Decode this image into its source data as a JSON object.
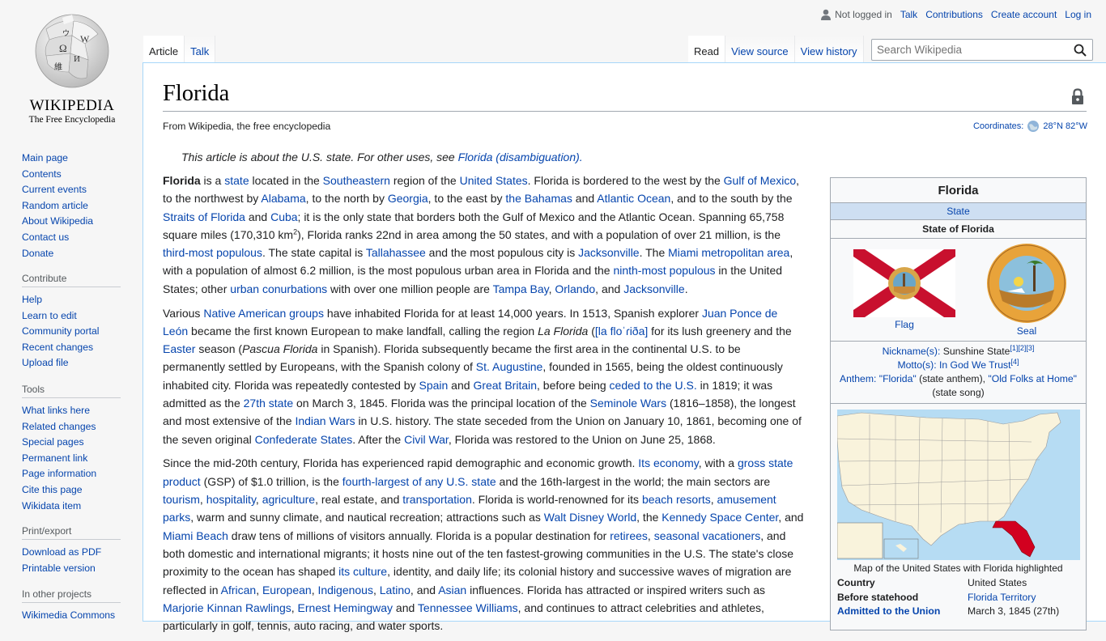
{
  "logo": {
    "wordmark": "WIKIPEDIA",
    "tagline": "The Free Encyclopedia"
  },
  "personal": {
    "not_logged_in": "Not logged in",
    "talk": "Talk",
    "contributions": "Contributions",
    "create_account": "Create account",
    "log_in": "Log in"
  },
  "tabs": {
    "article": "Article",
    "talk": "Talk",
    "read": "Read",
    "view_source": "View source",
    "view_history": "View history"
  },
  "search": {
    "placeholder": "Search Wikipedia"
  },
  "navigation": [
    "Main page",
    "Contents",
    "Current events",
    "Random article",
    "About Wikipedia",
    "Contact us",
    "Donate"
  ],
  "contribute": {
    "heading": "Contribute",
    "items": [
      "Help",
      "Learn to edit",
      "Community portal",
      "Recent changes",
      "Upload file"
    ]
  },
  "tools": {
    "heading": "Tools",
    "items": [
      "What links here",
      "Related changes",
      "Special pages",
      "Permanent link",
      "Page information",
      "Cite this page",
      "Wikidata item"
    ]
  },
  "print": {
    "heading": "Print/export",
    "items": [
      "Download as PDF",
      "Printable version"
    ]
  },
  "projects": {
    "heading": "In other projects",
    "items": [
      "Wikimedia Commons"
    ]
  },
  "article": {
    "title": "Florida",
    "from": "From Wikipedia, the free encyclopedia",
    "coords_label": "Coordinates:",
    "coords_value": "28°N 82°W",
    "hatnote_text": "This article is about the U.S. state. For other uses, see ",
    "hatnote_link": "Florida (disambiguation)."
  },
  "infobox": {
    "title": "Florida",
    "type": "State",
    "official": "State of Florida",
    "flag_caption": "Flag",
    "seal_caption": "Seal",
    "nickname_label": "Nickname(s):",
    "nickname": "Sunshine State",
    "nickname_refs": "[1][2][3]",
    "motto_label": "Motto(s):",
    "motto": "In God We Trust",
    "motto_ref": "[4]",
    "anthem_label": "Anthem:",
    "anthem1": "\"Florida\"",
    "anthem1_note": "(state anthem),",
    "anthem2": "\"Old Folks at Home\"",
    "anthem2_note": "(state song)",
    "map_caption": "Map of the United States with Florida highlighted",
    "rows": [
      {
        "k": "Country",
        "v": "United States"
      },
      {
        "k": "Before statehood",
        "v": "Florida Territory"
      },
      {
        "k": "Admitted to the Union",
        "v": "March 3, 1845 (27th)"
      }
    ]
  },
  "colors": {
    "link": "#0645ad",
    "flag_red": "#c8102e",
    "map_highlight": "#d2001f",
    "ocean": "#b6dcf3"
  }
}
